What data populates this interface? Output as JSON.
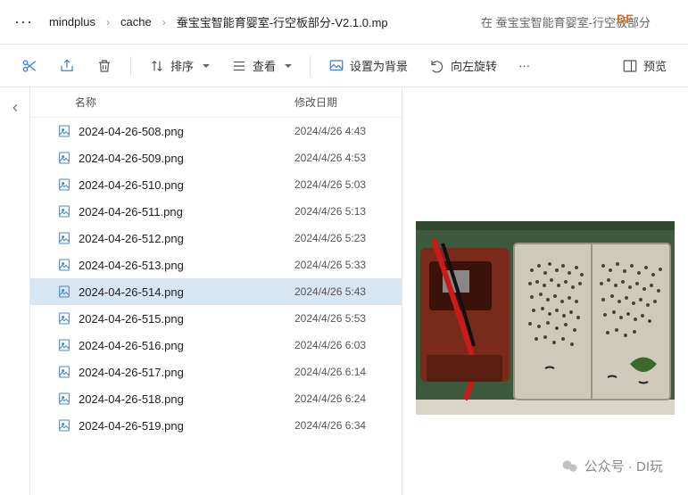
{
  "breadcrumb": {
    "more": "···",
    "items": [
      "mindplus",
      "cache",
      "蚕宝宝智能育婴室-行空板部分-V2.1.0.mp"
    ],
    "sep": "›"
  },
  "search": {
    "text": "在 蚕宝宝智能育婴室-行空板部分",
    "overlay": "DF"
  },
  "toolbar": {
    "sort": "排序",
    "view": "查看",
    "wallpaper": "设置为背景",
    "rotate": "向左旋转",
    "more": "···",
    "preview": "预览"
  },
  "columns": {
    "name": "名称",
    "date": "修改日期"
  },
  "files": [
    {
      "name": "2024-04-26-508.png",
      "date": "2024/4/26 4:43",
      "selected": false
    },
    {
      "name": "2024-04-26-509.png",
      "date": "2024/4/26 4:53",
      "selected": false
    },
    {
      "name": "2024-04-26-510.png",
      "date": "2024/4/26 5:03",
      "selected": false
    },
    {
      "name": "2024-04-26-511.png",
      "date": "2024/4/26 5:13",
      "selected": false
    },
    {
      "name": "2024-04-26-512.png",
      "date": "2024/4/26 5:23",
      "selected": false
    },
    {
      "name": "2024-04-26-513.png",
      "date": "2024/4/26 5:33",
      "selected": false
    },
    {
      "name": "2024-04-26-514.png",
      "date": "2024/4/26 5:43",
      "selected": true
    },
    {
      "name": "2024-04-26-515.png",
      "date": "2024/4/26 5:53",
      "selected": false
    },
    {
      "name": "2024-04-26-516.png",
      "date": "2024/4/26 6:03",
      "selected": false
    },
    {
      "name": "2024-04-26-517.png",
      "date": "2024/4/26 6:14",
      "selected": false
    },
    {
      "name": "2024-04-26-518.png",
      "date": "2024/4/26 6:24",
      "selected": false
    },
    {
      "name": "2024-04-26-519.png",
      "date": "2024/4/26 6:34",
      "selected": false
    }
  ],
  "watermark": "公众号 · DI玩"
}
